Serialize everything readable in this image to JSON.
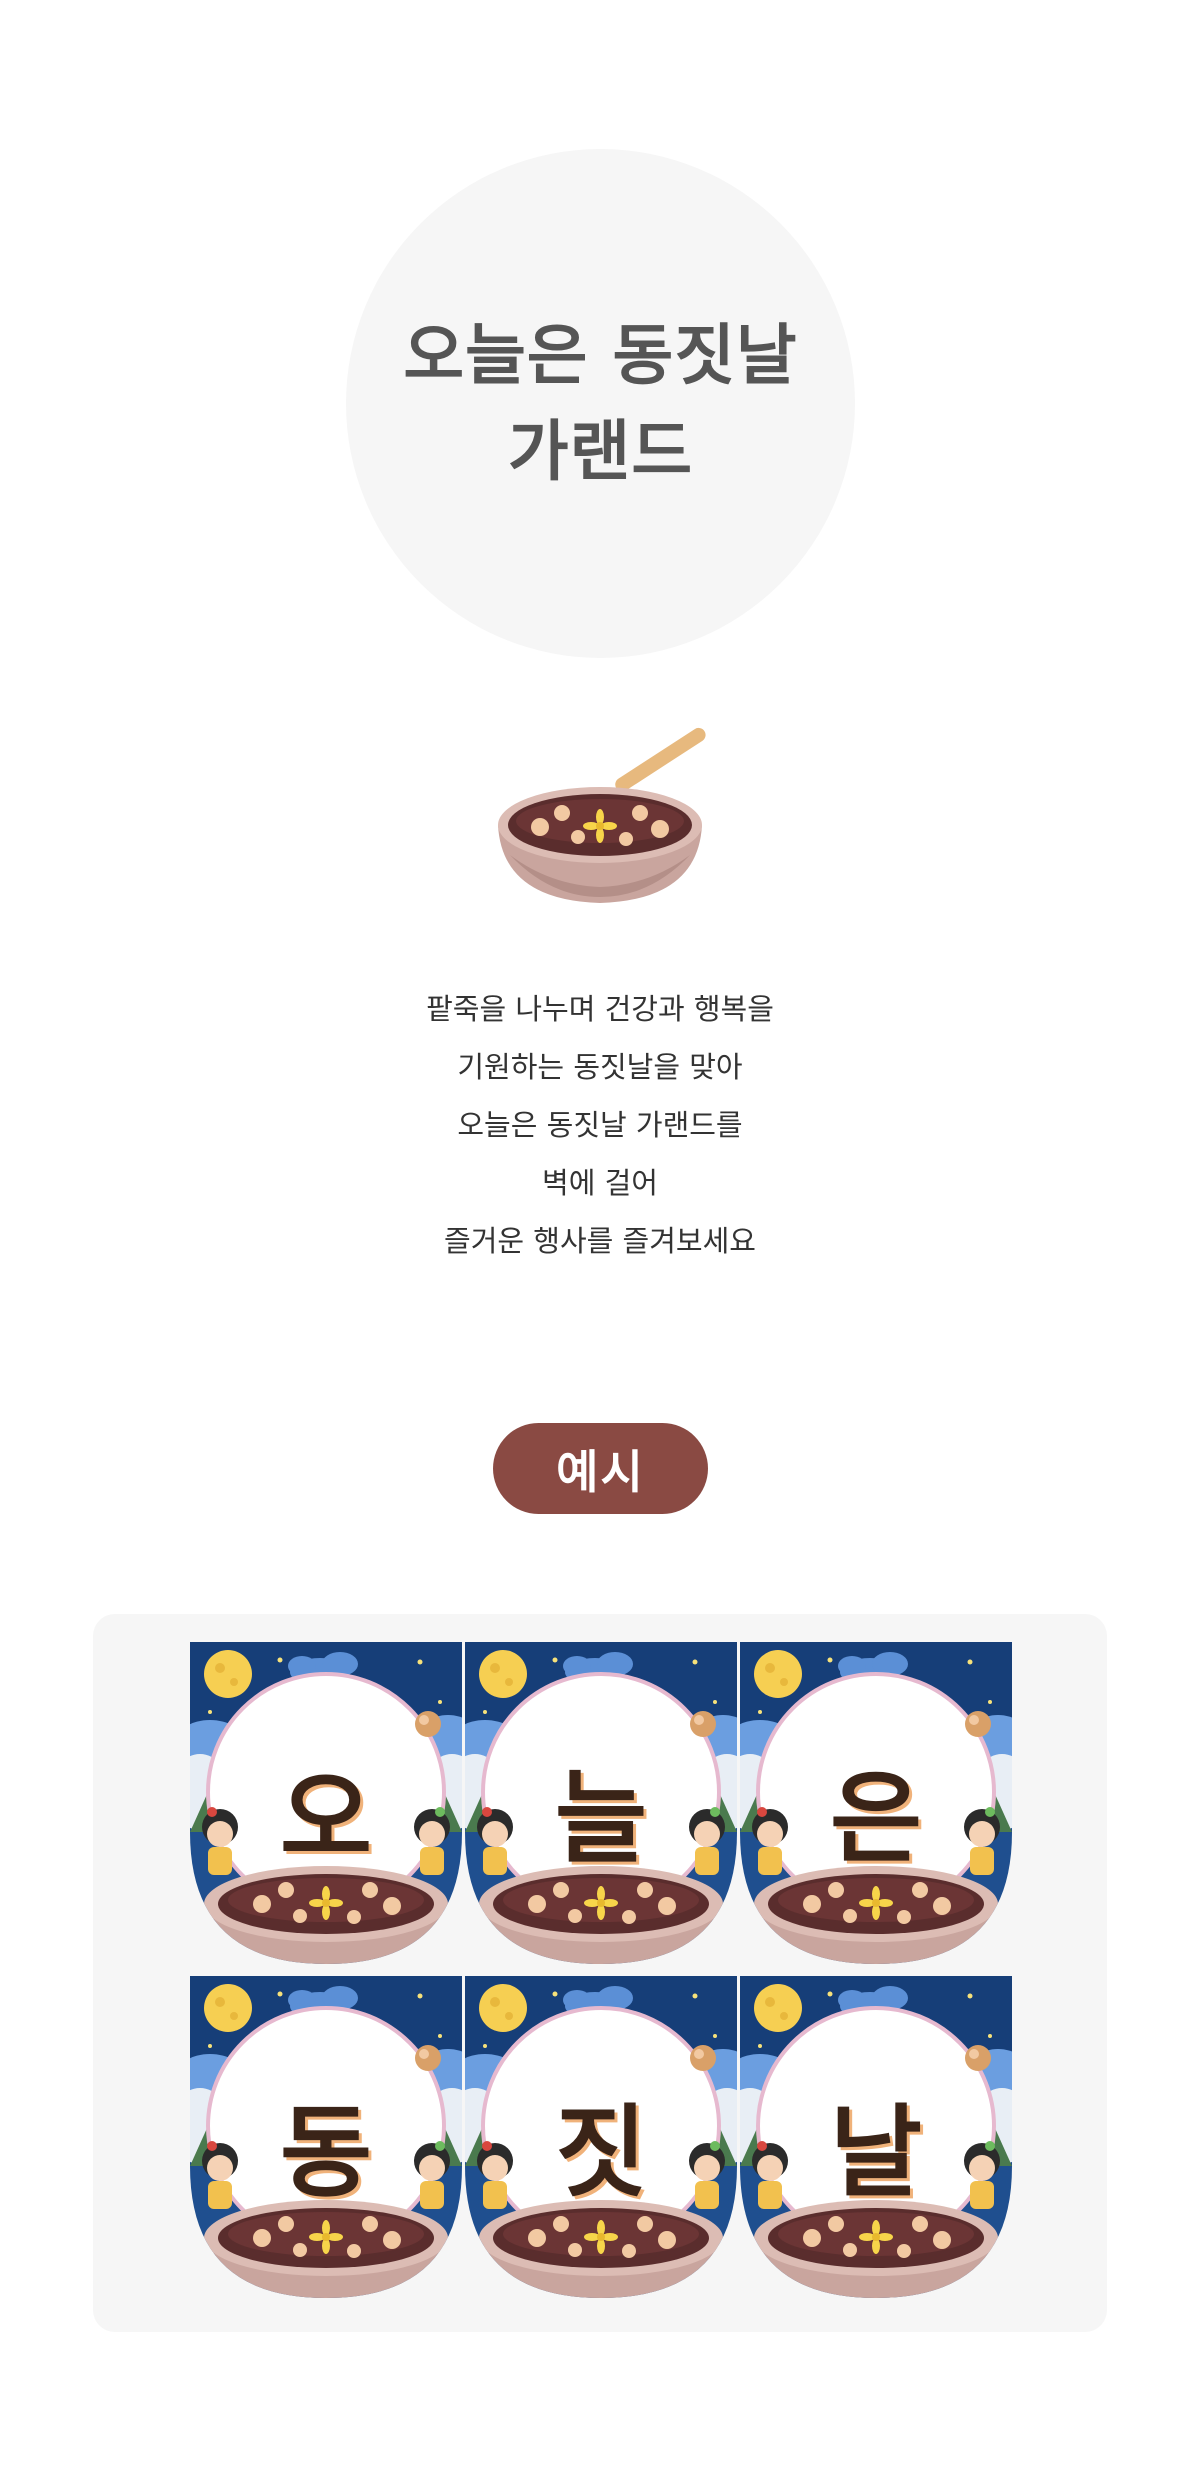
{
  "title": {
    "line1": "오늘은 동짓날",
    "line2": "가랜드"
  },
  "description": [
    "팥죽을 나누며 건강과 행복을",
    "기원하는 동짓날을 맞아",
    "오늘은 동짓날 가랜드를",
    "벽에 걸어",
    "즐거운 행사를 즐겨보세요"
  ],
  "badge": {
    "label": "예시"
  },
  "flags": [
    {
      "letter": "오"
    },
    {
      "letter": "늘"
    },
    {
      "letter": "은"
    },
    {
      "letter": "동"
    },
    {
      "letter": "짓"
    },
    {
      "letter": "날"
    }
  ],
  "colors": {
    "badge_bg": "#8a4a43",
    "title_text": "#555555",
    "circle_bg": "#f6f6f6",
    "panel_bg": "#f6f6f6",
    "night_sky": "#1f4f8f",
    "red_bean_porridge": "#5a2d2d"
  }
}
